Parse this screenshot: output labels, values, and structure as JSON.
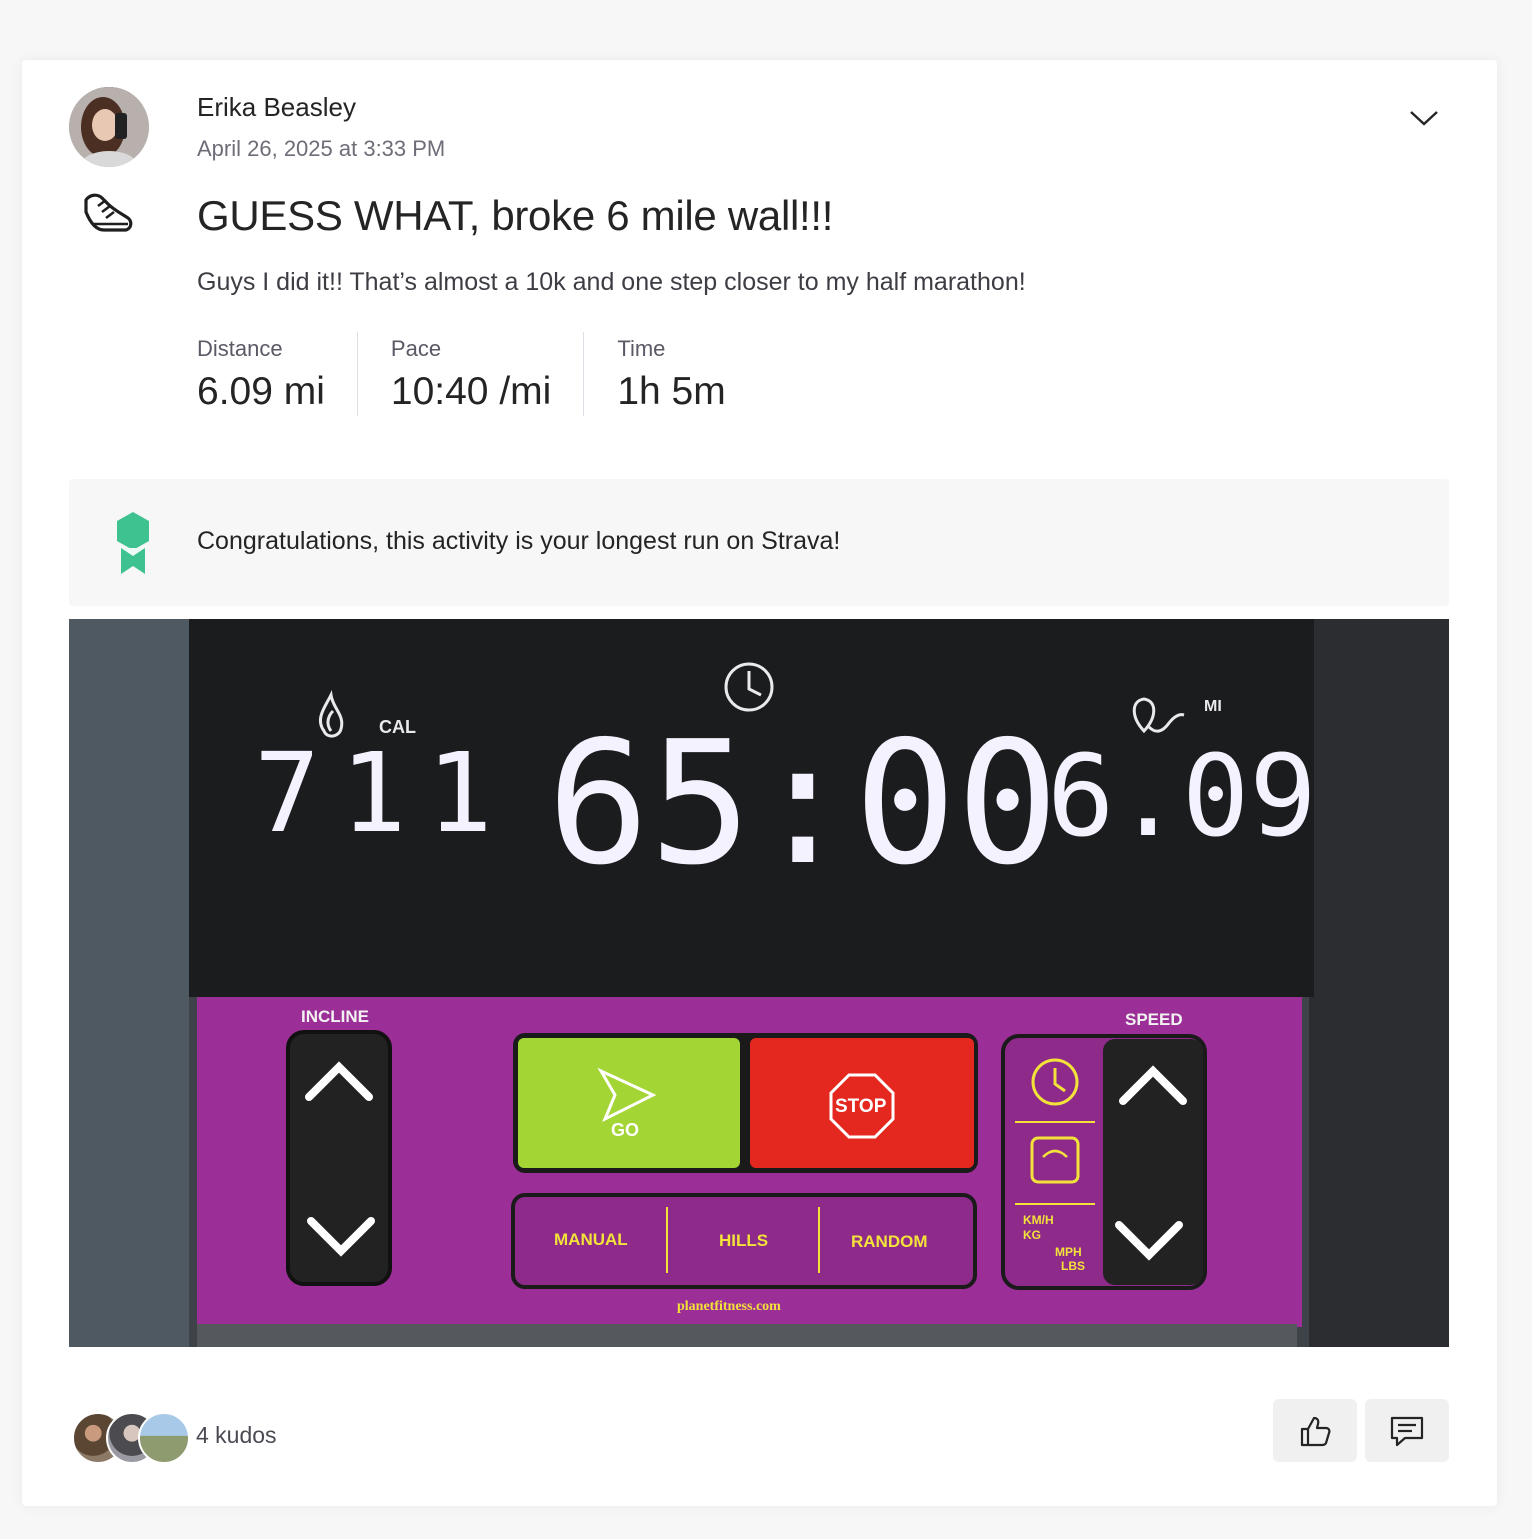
{
  "athlete": {
    "name": "Erika Beasley",
    "timestamp": "April 26, 2025 at 3:33 PM"
  },
  "activity": {
    "type_icon": "run-shoe-icon",
    "title": "GUESS WHAT, broke 6 mile wall!!!",
    "description": "Guys I did it!! That’s almost a 10k and one step closer to my half marathon!",
    "stats": [
      {
        "label": "Distance",
        "value": "6.09 mi"
      },
      {
        "label": "Pace",
        "value": "10:40 /mi"
      },
      {
        "label": "Time",
        "value": "1h 5m"
      }
    ]
  },
  "achievement": {
    "icon": "medal-icon",
    "text": "Congratulations, this activity is your longest run on Strava!"
  },
  "photo": {
    "display": {
      "cal_label": "CAL",
      "cal_value": "711",
      "time_value": "65:00",
      "mi_label": "MI",
      "distance_value": "6.09"
    },
    "panel": {
      "incline_label": "INCLINE",
      "speed_label": "SPEED",
      "go_label": "GO",
      "stop_label": "STOP",
      "manual_label": "MANUAL",
      "hills_label": "HILLS",
      "random_label": "RANDOM",
      "units_top": "KM/H",
      "units_kg": "KG",
      "units_mph": "MPH",
      "units_lbs": "LBS",
      "brand_url": "planetfitness.com"
    }
  },
  "social": {
    "kudos_count": "4 kudos",
    "give_kudos_icon": "thumbs-up-icon",
    "comment_icon": "comment-icon"
  },
  "colors": {
    "panel_purple": "#9b2f97",
    "go_green": "#a3d534",
    "stop_red": "#e5281f",
    "medal_green": "#3ec28f",
    "accent_yellow": "#f2e23a"
  }
}
